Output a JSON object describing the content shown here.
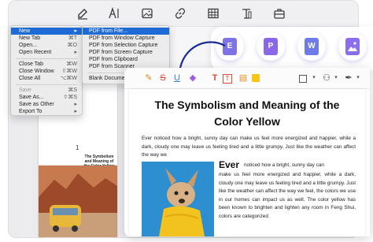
{
  "menu": {
    "items": [
      {
        "label": "New",
        "shortcut": "▸",
        "selected": true
      },
      {
        "label": "New Tab",
        "shortcut": "⌘T"
      },
      {
        "label": "Open...",
        "shortcut": "⌘O"
      },
      {
        "label": "Open Recent",
        "shortcut": "▸"
      },
      {
        "label": "Close Tab",
        "shortcut": "⌘W"
      },
      {
        "label": "Close Window",
        "shortcut": "⇧⌘W"
      },
      {
        "label": "Close All",
        "shortcut": "⌥⌘W"
      },
      {
        "label": "Save",
        "shortcut": "⌘S",
        "disabled": true
      },
      {
        "label": "Save As...",
        "shortcut": "⇧⌘S"
      },
      {
        "label": "Save as Other",
        "shortcut": "▸"
      },
      {
        "label": "Export To",
        "shortcut": "▸"
      }
    ]
  },
  "submenu": {
    "items": [
      "PDF from File...",
      "PDF from Window Capture",
      "PDF from Selection Capture",
      "PDF from Screen Capture",
      "PDF from Clipboard",
      "PDF from Scanner",
      "Blank Document"
    ]
  },
  "thumbnails": {
    "page1_title": "The Symbolism and Meaning of the Color Yellow",
    "page1_number": "1"
  },
  "conversion": {
    "icons": [
      "E",
      "P",
      "W"
    ]
  },
  "document": {
    "title_line1": "The Symbolism and Meaning of the",
    "title_line2": "Color Yellow",
    "intro": "Ever noticed how a bright, sunny day can make us feel more energized and happier, while a dark, cloudy one may leave us feeling tired and a little grumpy. Just like the weather can affect the way we",
    "dropcap": "Ever",
    "side_first": "noticed how a bright, sunny day can",
    "side_rest": "make us feel more energized and happier, while a dark, cloudy one may leave us feeling tired and a little grumpy. Just like the weather can affect the way we feel, the colors we use in our homes can impact us as well. The color yellow has been known to brighten and lighten any room in Feng Shui, colors are categorized"
  },
  "colors": {
    "accent": "#1f6bd6",
    "violet": "#7b5cf0",
    "arrow": "#1a2a9c",
    "excel": "#7d72e6",
    "ppt": "#8a66e8",
    "word": "#6f7be8"
  }
}
